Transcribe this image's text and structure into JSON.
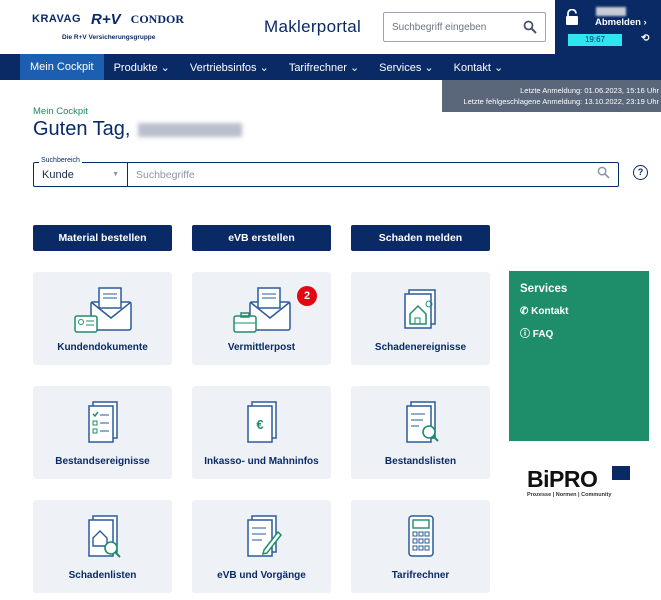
{
  "header": {
    "logo_kravag": "KRAVAG",
    "logo_rv": "R+V",
    "logo_condor": "CONDOR",
    "logo_group": "Die R+V Versicherungsgruppe",
    "portal_title": "Maklerportal",
    "search_placeholder": "Suchbegriff eingeben",
    "logout_label": "Abmelden ›",
    "session_timer": "19:67"
  },
  "nav": {
    "items": [
      {
        "label": "Mein Cockpit",
        "active": true
      },
      {
        "label": "Produkte ⌄"
      },
      {
        "label": "Vertriebsinfos ⌄"
      },
      {
        "label": "Tarifrechner ⌄"
      },
      {
        "label": "Services ⌄"
      },
      {
        "label": "Kontakt ⌄"
      }
    ]
  },
  "login_info": {
    "last_login": "Letzte Anmeldung: 01.06.2023, 15:16 Uhr",
    "last_failed": "Letzte fehlgeschlagene Anmeldung: 13.10.2022, 23:19 Uhr"
  },
  "main": {
    "breadcrumb": "Mein Cockpit",
    "greeting": "Guten Tag,",
    "search": {
      "legend": "Suchbereich",
      "area_value": "Kunde",
      "placeholder": "Suchbegriffe"
    },
    "actions": [
      "Material bestellen",
      "eVB erstellen",
      "Schaden melden"
    ],
    "tiles": [
      {
        "label": "Kundendokumente",
        "icon": "documents-envelope-icon"
      },
      {
        "label": "Vermittlerpost",
        "icon": "mail-briefcase-icon",
        "badge": "2"
      },
      {
        "label": "Schadenereignisse",
        "icon": "house-damage-document-icon"
      },
      {
        "label": "Bestandsereignisse",
        "icon": "checklist-document-icon"
      },
      {
        "label": "Inkasso- und Mahninfos",
        "icon": "euro-document-icon"
      },
      {
        "label": "Bestandslisten",
        "icon": "list-search-document-icon"
      },
      {
        "label": "Schadenlisten",
        "icon": "house-search-document-icon"
      },
      {
        "label": "eVB und Vorgänge",
        "icon": "document-pen-icon"
      },
      {
        "label": "Tarifrechner",
        "icon": "calculator-icon"
      }
    ]
  },
  "services_panel": {
    "title": "Services",
    "links": [
      "Kontakt",
      "FAQ"
    ]
  },
  "bipro": {
    "word": "BiPRO",
    "tagline": "Prozesse | Normen | Community"
  },
  "colors": {
    "brand_navy": "#0a2a66",
    "nav_active": "#1c5fb0",
    "accent_green": "#1e8e6a",
    "badge_red": "#e30613",
    "timer_cyan": "#2ee6f0"
  }
}
